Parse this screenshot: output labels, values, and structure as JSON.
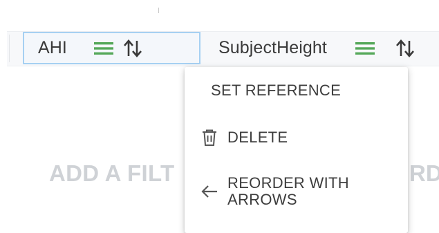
{
  "columns": [
    {
      "name": "AHI",
      "selected": true
    },
    {
      "name": "SubjectHeight",
      "selected": false
    }
  ],
  "empty_state": {
    "hint_left": "ADD A FILT",
    "hint_right": "RD"
  },
  "context_menu": {
    "items": [
      {
        "label": "SET REFERENCE",
        "icon": null
      },
      {
        "label": "DELETE",
        "icon": "trash-icon"
      },
      {
        "label": "REORDER WITH ARROWS",
        "icon": "arrow-left-icon"
      }
    ]
  },
  "colors": {
    "menu_icon_green": "#56a85a",
    "selected_border": "#a6d0f2",
    "hint_gray": "#cfd2d6"
  }
}
